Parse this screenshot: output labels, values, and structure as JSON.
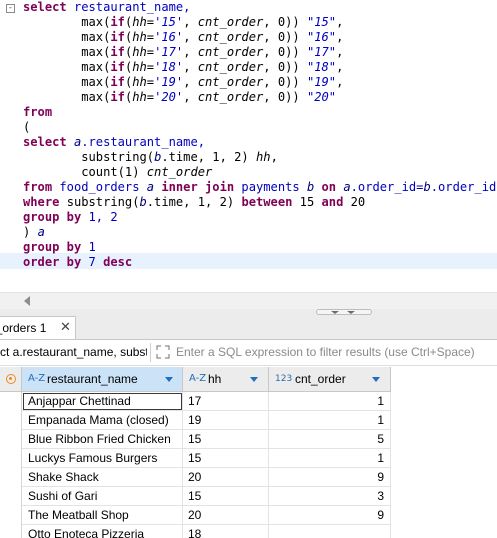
{
  "editor": {
    "collapse_glyph": "-",
    "lines": [
      [
        {
          "t": "select",
          "c": "kw"
        },
        {
          "t": " restaurant_name,",
          "c": "ident"
        }
      ],
      [
        {
          "t": "        "
        },
        {
          "t": "max",
          "c": "func"
        },
        {
          "t": "(",
          "c": ""
        },
        {
          "t": "if",
          "c": "kw"
        },
        {
          "t": "(",
          "c": ""
        },
        {
          "t": "hh",
          "c": "ital"
        },
        {
          "t": "=",
          "c": ""
        },
        {
          "t": "'15'",
          "c": "str"
        },
        {
          "t": ", ",
          "c": ""
        },
        {
          "t": "cnt_order",
          "c": "ital"
        },
        {
          "t": ", 0)) ",
          "c": ""
        },
        {
          "t": "\"15\"",
          "c": "str"
        },
        {
          "t": ",",
          "c": ""
        }
      ],
      [
        {
          "t": "        "
        },
        {
          "t": "max",
          "c": "func"
        },
        {
          "t": "(",
          "c": ""
        },
        {
          "t": "if",
          "c": "kw"
        },
        {
          "t": "(",
          "c": ""
        },
        {
          "t": "hh",
          "c": "ital"
        },
        {
          "t": "=",
          "c": ""
        },
        {
          "t": "'16'",
          "c": "str"
        },
        {
          "t": ", ",
          "c": ""
        },
        {
          "t": "cnt_order",
          "c": "ital"
        },
        {
          "t": ", 0)) ",
          "c": ""
        },
        {
          "t": "\"16\"",
          "c": "str"
        },
        {
          "t": ",",
          "c": ""
        }
      ],
      [
        {
          "t": "        "
        },
        {
          "t": "max",
          "c": "func"
        },
        {
          "t": "(",
          "c": ""
        },
        {
          "t": "if",
          "c": "kw"
        },
        {
          "t": "(",
          "c": ""
        },
        {
          "t": "hh",
          "c": "ital"
        },
        {
          "t": "=",
          "c": ""
        },
        {
          "t": "'17'",
          "c": "str"
        },
        {
          "t": ", ",
          "c": ""
        },
        {
          "t": "cnt_order",
          "c": "ital"
        },
        {
          "t": ", 0)) ",
          "c": ""
        },
        {
          "t": "\"17\"",
          "c": "str"
        },
        {
          "t": ",",
          "c": ""
        }
      ],
      [
        {
          "t": "        "
        },
        {
          "t": "max",
          "c": "func"
        },
        {
          "t": "(",
          "c": ""
        },
        {
          "t": "if",
          "c": "kw"
        },
        {
          "t": "(",
          "c": ""
        },
        {
          "t": "hh",
          "c": "ital"
        },
        {
          "t": "=",
          "c": ""
        },
        {
          "t": "'18'",
          "c": "str"
        },
        {
          "t": ", ",
          "c": ""
        },
        {
          "t": "cnt_order",
          "c": "ital"
        },
        {
          "t": ", 0)) ",
          "c": ""
        },
        {
          "t": "\"18\"",
          "c": "str"
        },
        {
          "t": ",",
          "c": ""
        }
      ],
      [
        {
          "t": "        "
        },
        {
          "t": "max",
          "c": "func"
        },
        {
          "t": "(",
          "c": ""
        },
        {
          "t": "if",
          "c": "kw"
        },
        {
          "t": "(",
          "c": ""
        },
        {
          "t": "hh",
          "c": "ital"
        },
        {
          "t": "=",
          "c": ""
        },
        {
          "t": "'19'",
          "c": "str"
        },
        {
          "t": ", ",
          "c": ""
        },
        {
          "t": "cnt_order",
          "c": "ital"
        },
        {
          "t": ", 0)) ",
          "c": ""
        },
        {
          "t": "\"19\"",
          "c": "str"
        },
        {
          "t": ",",
          "c": ""
        }
      ],
      [
        {
          "t": "        "
        },
        {
          "t": "max",
          "c": "func"
        },
        {
          "t": "(",
          "c": ""
        },
        {
          "t": "if",
          "c": "kw"
        },
        {
          "t": "(",
          "c": ""
        },
        {
          "t": "hh",
          "c": "ital"
        },
        {
          "t": "=",
          "c": ""
        },
        {
          "t": "'20'",
          "c": "str"
        },
        {
          "t": ", ",
          "c": ""
        },
        {
          "t": "cnt_order",
          "c": "ital"
        },
        {
          "t": ", 0)) ",
          "c": ""
        },
        {
          "t": "\"20\"",
          "c": "str"
        }
      ],
      [
        {
          "t": "from",
          "c": "kw"
        }
      ],
      [
        {
          "t": "("
        }
      ],
      [
        {
          "t": "select",
          "c": "kw"
        },
        {
          "t": " "
        },
        {
          "t": "a",
          "c": "alias"
        },
        {
          "t": ".restaurant_name,",
          "c": "ident"
        }
      ],
      [
        {
          "t": "        "
        },
        {
          "t": "substring",
          "c": "func"
        },
        {
          "t": "("
        },
        {
          "t": "b",
          "c": "alias"
        },
        {
          "t": ".time, 1, 2) "
        },
        {
          "t": "hh",
          "c": "ital"
        },
        {
          "t": ","
        }
      ],
      [
        {
          "t": "        "
        },
        {
          "t": "count",
          "c": "func"
        },
        {
          "t": "(1) "
        },
        {
          "t": "cnt_order",
          "c": "ital"
        }
      ],
      [
        {
          "t": "from",
          "c": "kw"
        },
        {
          "t": " food_orders ",
          "c": "ident"
        },
        {
          "t": "a",
          "c": "alias"
        },
        {
          "t": " "
        },
        {
          "t": "inner join",
          "c": "kw"
        },
        {
          "t": " payments ",
          "c": "ident"
        },
        {
          "t": "b",
          "c": "alias"
        },
        {
          "t": " "
        },
        {
          "t": "on",
          "c": "kw"
        },
        {
          "t": " "
        },
        {
          "t": "a",
          "c": "alias"
        },
        {
          "t": ".order_id=",
          "c": "ident"
        },
        {
          "t": "b",
          "c": "alias"
        },
        {
          "t": ".order_id",
          "c": "ident"
        }
      ],
      [
        {
          "t": "where",
          "c": "kw"
        },
        {
          "t": " "
        },
        {
          "t": "substring",
          "c": "func"
        },
        {
          "t": "("
        },
        {
          "t": "b",
          "c": "alias"
        },
        {
          "t": ".time, 1, 2) "
        },
        {
          "t": "between",
          "c": "kw"
        },
        {
          "t": " 15 "
        },
        {
          "t": "and",
          "c": "kw"
        },
        {
          "t": " 20"
        }
      ],
      [
        {
          "t": "group by",
          "c": "kw"
        },
        {
          "t": " 1, 2",
          "c": "num"
        }
      ],
      [
        {
          "t": ") "
        },
        {
          "t": "a",
          "c": "alias"
        }
      ],
      [
        {
          "t": "group by",
          "c": "kw"
        },
        {
          "t": " 1",
          "c": "num"
        }
      ],
      [
        {
          "t": "order by",
          "c": "kw"
        },
        {
          "t": " 7 ",
          "c": "num"
        },
        {
          "t": "desc",
          "c": "kw"
        }
      ]
    ]
  },
  "results_tab": {
    "label": "l_orders 1",
    "close_glyph": "✕"
  },
  "filter": {
    "current_text": "ct a.restaurant_name, substr",
    "placeholder": "Enter a SQL expression to filter results (use Ctrl+Space)"
  },
  "grid": {
    "columns": [
      {
        "type_icon": "A-Z",
        "name": "restaurant_name"
      },
      {
        "type_icon": "A-Z",
        "name": "hh"
      },
      {
        "type_icon": "123",
        "name": "cnt_order"
      }
    ],
    "rows": [
      [
        "Anjappar Chettinad",
        "17",
        "1"
      ],
      [
        "Empanada Mama (closed)",
        "19",
        "1"
      ],
      [
        "Blue Ribbon Fried Chicken",
        "15",
        "5"
      ],
      [
        "Luckys Famous Burgers",
        "15",
        "1"
      ],
      [
        "Shake Shack",
        "20",
        "9"
      ],
      [
        "Sushi of Gari",
        "15",
        "3"
      ],
      [
        "The Meatball Shop",
        "20",
        "9"
      ],
      [
        "Otto Enoteca Pizzeria",
        "18",
        ""
      ]
    ]
  },
  "colors": {
    "keyword": "#7f0055",
    "identifier": "#0000c0",
    "current_line": "#e8f2fe",
    "header_selected": "#cce3f7",
    "accent_orange": "#e88d23"
  }
}
